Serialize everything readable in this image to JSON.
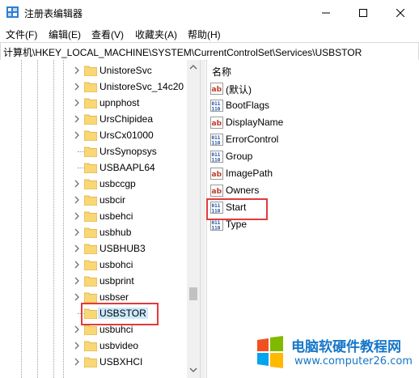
{
  "window": {
    "title": "注册表编辑器"
  },
  "menu": [
    "文件(F)",
    "编辑(E)",
    "查看(V)",
    "收藏夹(A)",
    "帮助(H)"
  ],
  "address": "计算机\\HKEY_LOCAL_MACHINE\\SYSTEM\\CurrentControlSet\\Services\\USBSTOR",
  "tree": {
    "items": [
      {
        "label": "UnistoreSvc",
        "expandable": true
      },
      {
        "label": "UnistoreSvc_14c20",
        "expandable": true
      },
      {
        "label": "upnphost",
        "expandable": true
      },
      {
        "label": "UrsChipidea",
        "expandable": true
      },
      {
        "label": "UrsCx01000",
        "expandable": true
      },
      {
        "label": "UrsSynopsys",
        "expandable": false
      },
      {
        "label": "USBAAPL64",
        "expandable": false
      },
      {
        "label": "usbccgp",
        "expandable": true
      },
      {
        "label": "usbcir",
        "expandable": true
      },
      {
        "label": "usbehci",
        "expandable": true
      },
      {
        "label": "usbhub",
        "expandable": true
      },
      {
        "label": "USBHUB3",
        "expandable": true
      },
      {
        "label": "usbohci",
        "expandable": true
      },
      {
        "label": "usbprint",
        "expandable": true
      },
      {
        "label": "usbser",
        "expandable": true
      },
      {
        "label": "USBSTOR",
        "expandable": false,
        "selected": true
      },
      {
        "label": "usbuhci",
        "expandable": true
      },
      {
        "label": "usbvideo",
        "expandable": true
      },
      {
        "label": "USBXHCI",
        "expandable": true
      }
    ]
  },
  "values": {
    "header": "名称",
    "items": [
      {
        "name": "(默认)",
        "type": "string"
      },
      {
        "name": "BootFlags",
        "type": "binary"
      },
      {
        "name": "DisplayName",
        "type": "string"
      },
      {
        "name": "ErrorControl",
        "type": "binary"
      },
      {
        "name": "Group",
        "type": "binary"
      },
      {
        "name": "ImagePath",
        "type": "string"
      },
      {
        "name": "Owners",
        "type": "string"
      },
      {
        "name": "Start",
        "type": "binary",
        "highlighted": true
      },
      {
        "name": "Type",
        "type": "binary"
      }
    ]
  },
  "watermark": {
    "text": "电脑软硬件教程网",
    "url": "www.computer26.com"
  },
  "colors": {
    "highlight_border": "#e23b3b",
    "selection": "#cce8ff",
    "folder": "#f8d775",
    "watermark_blue": "#1776c8"
  }
}
